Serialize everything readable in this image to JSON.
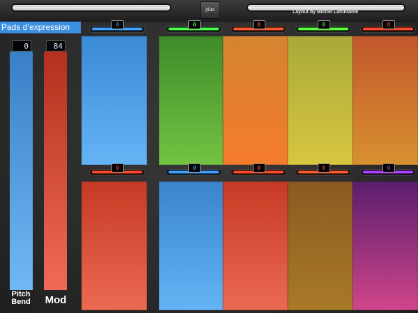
{
  "toolbar": {
    "plus_label": "plus",
    "credit": "Layout by Michel Lafontaine"
  },
  "title": "Pads d’expression",
  "controls": {
    "pitch": {
      "label_line1": "Pitch",
      "label_line2": "Bend",
      "value": "0"
    },
    "mod": {
      "label": "Mod",
      "value": "84"
    }
  },
  "pads": {
    "top": [
      {
        "value": "0",
        "accent": "#3fa4ff",
        "color_top": "#3a8ad6",
        "color_bottom": "#64b4f5"
      },
      {
        "value": "0",
        "accent": "#4bff4b",
        "color_top": "#3f8a2a",
        "color_bottom": "#73c443"
      },
      {
        "value": "0",
        "accent": "#ff5a2e",
        "color_top": "#d58430",
        "color_bottom": "#f47c2c"
      },
      {
        "value": "0",
        "accent": "#5aff3e",
        "color_top": "#a8a93a",
        "color_bottom": "#d8c640"
      },
      {
        "value": "0",
        "accent": "#ff4a2a",
        "color_top": "#c2582c",
        "color_bottom": "#d89030"
      }
    ],
    "bottom": [
      {
        "value": "0",
        "accent": "#ff4a2a",
        "color_top": "#c53a24",
        "color_bottom": "#ec6a52"
      },
      {
        "value": "0",
        "accent": "#3fa4ff",
        "color_top": "#3a84cc",
        "color_bottom": "#64b4f5"
      },
      {
        "value": "0",
        "accent": "#ff4a2a",
        "color_top": "#c53a24",
        "color_bottom": "#ec6a52"
      },
      {
        "value": "0",
        "accent": "#ff5a2e",
        "color_top": "#8a5a22",
        "color_bottom": "#a87a26"
      },
      {
        "value": "0",
        "accent": "#b040ff",
        "color_top": "#5a1e6e",
        "color_bottom": "#d0458a"
      }
    ]
  }
}
